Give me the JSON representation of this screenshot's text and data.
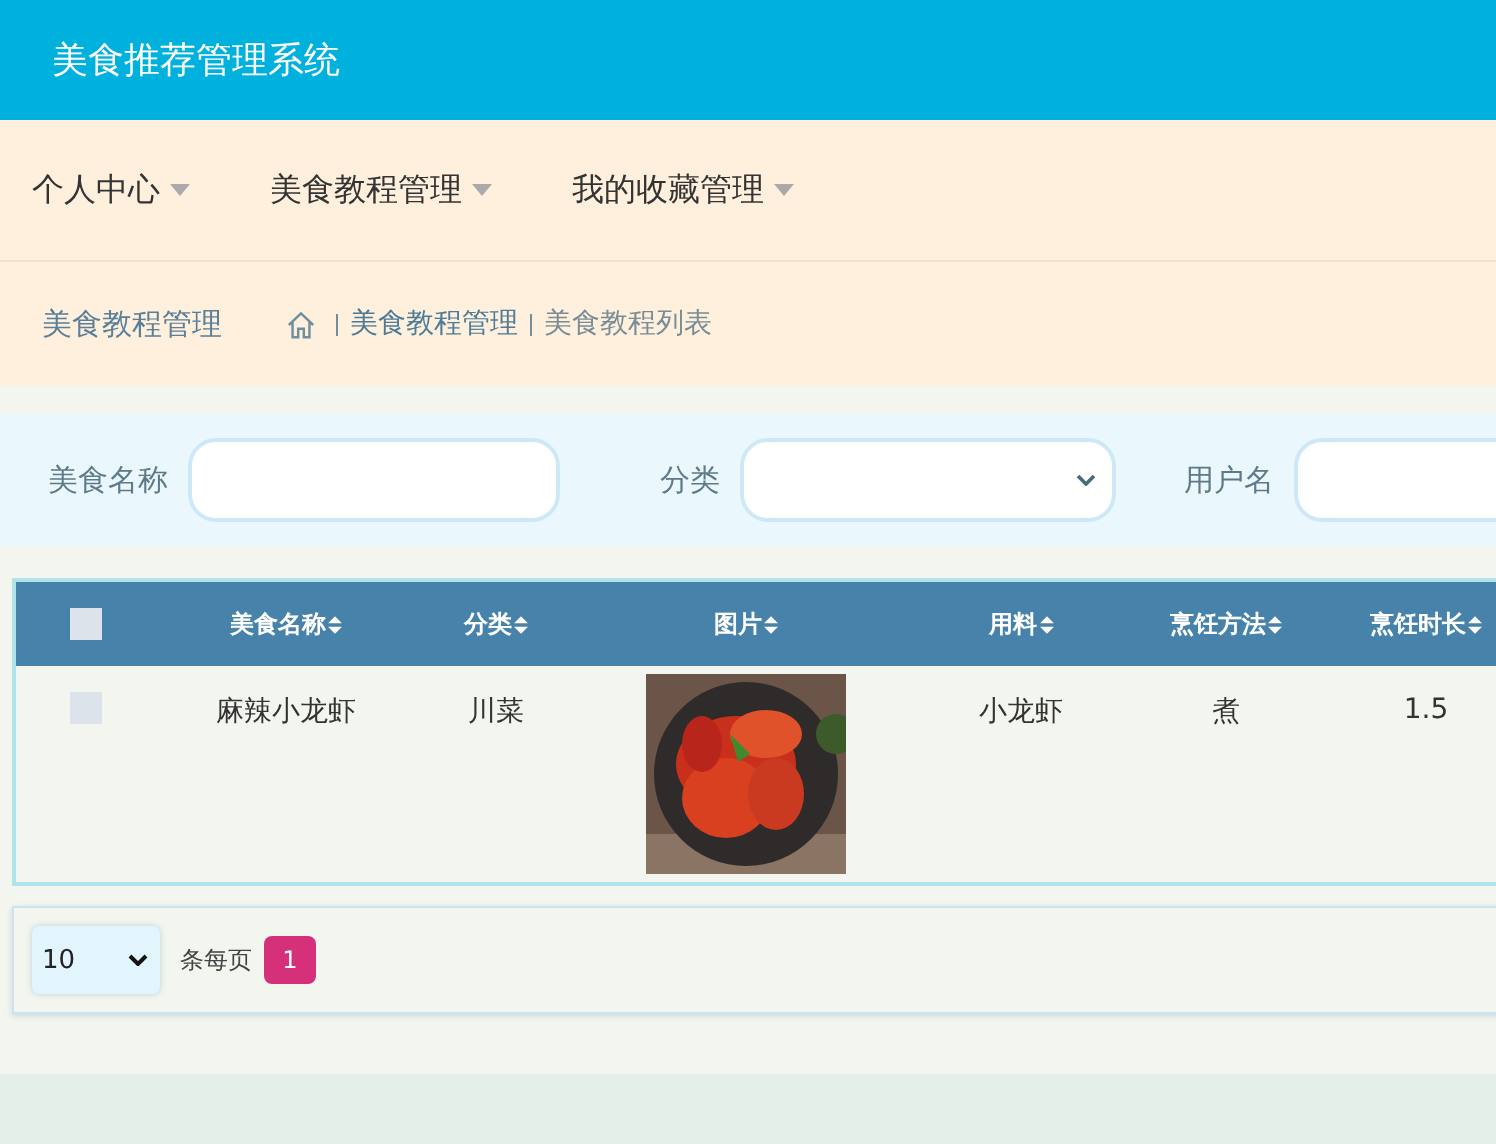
{
  "header": {
    "title": "美食推荐管理系统"
  },
  "nav": [
    {
      "label": "个人中心",
      "expanded": false
    },
    {
      "label": "美食教程管理",
      "expanded": false
    },
    {
      "label": "我的收藏管理",
      "expanded": false
    }
  ],
  "breadcrumb": {
    "section": "美食教程管理",
    "items": [
      "美食教程管理",
      "美食教程列表"
    ]
  },
  "filters": [
    {
      "label": "美食名称",
      "kind": "text"
    },
    {
      "label": "分类",
      "kind": "select"
    },
    {
      "label": "用户名",
      "kind": "text"
    }
  ],
  "table": {
    "all_checked": false,
    "columns": [
      "美食名称",
      "分类",
      "图片",
      "用料",
      "烹饪方法",
      "烹饪时长"
    ],
    "rows": [
      {
        "checked": false,
        "cells": [
          "麻辣小龙虾",
          "川菜",
          {
            "kind": "picture"
          },
          "小龙虾",
          "煮",
          "1.5"
        ]
      }
    ]
  },
  "pagination": {
    "page_size": "10",
    "per_page_label": "条每页",
    "pages": [
      {
        "label": "1",
        "selected": true
      }
    ]
  }
}
